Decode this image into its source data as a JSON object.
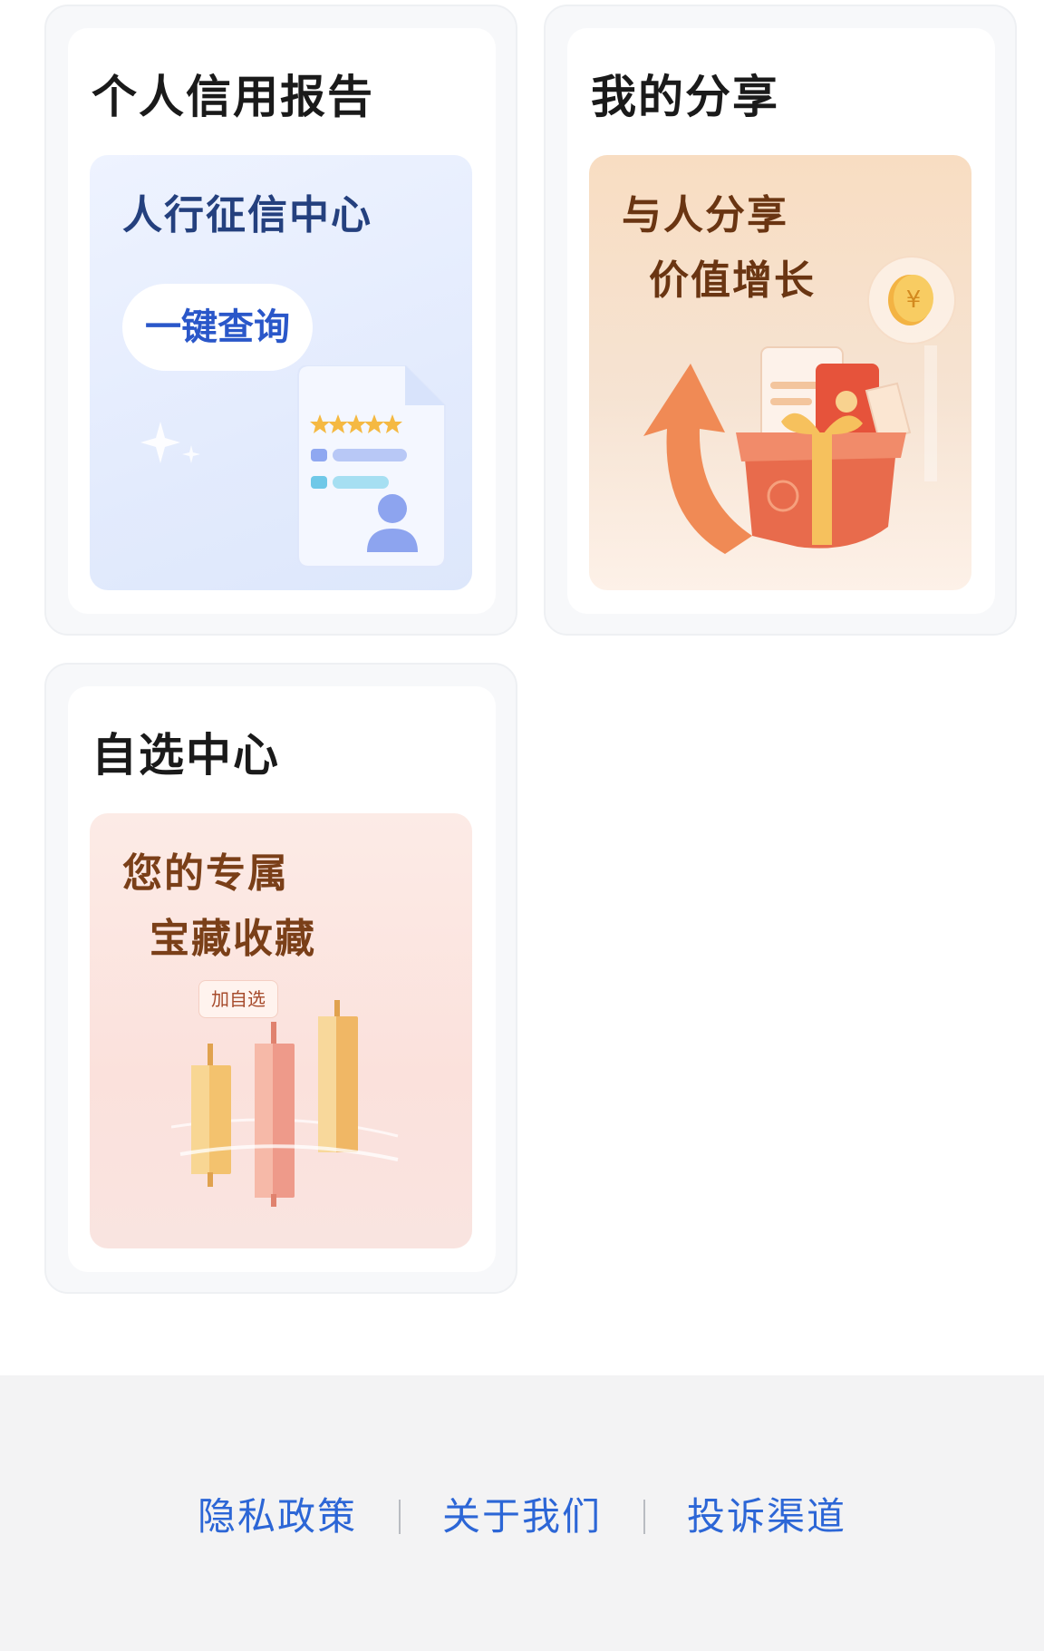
{
  "cards": {
    "credit": {
      "title": "个人信用报告",
      "banner_line1": "人行征信中心",
      "button_label": "一键查询"
    },
    "share": {
      "title": "我的分享",
      "banner_line1": "与人分享",
      "banner_line2": "价值增长"
    },
    "watchlist": {
      "title": "自选中心",
      "banner_line1": "您的专属",
      "banner_line2": "宝藏收藏",
      "tag_label": "加自选"
    }
  },
  "footer": {
    "links": [
      "隐私政策",
      "关于我们",
      "投诉渠道"
    ]
  },
  "colors": {
    "link": "#2c66d6",
    "credit_accent": "#2a57c9",
    "share_text": "#6a3512",
    "watch_text": "#7a3f18",
    "footer_bg": "#f3f3f4"
  }
}
